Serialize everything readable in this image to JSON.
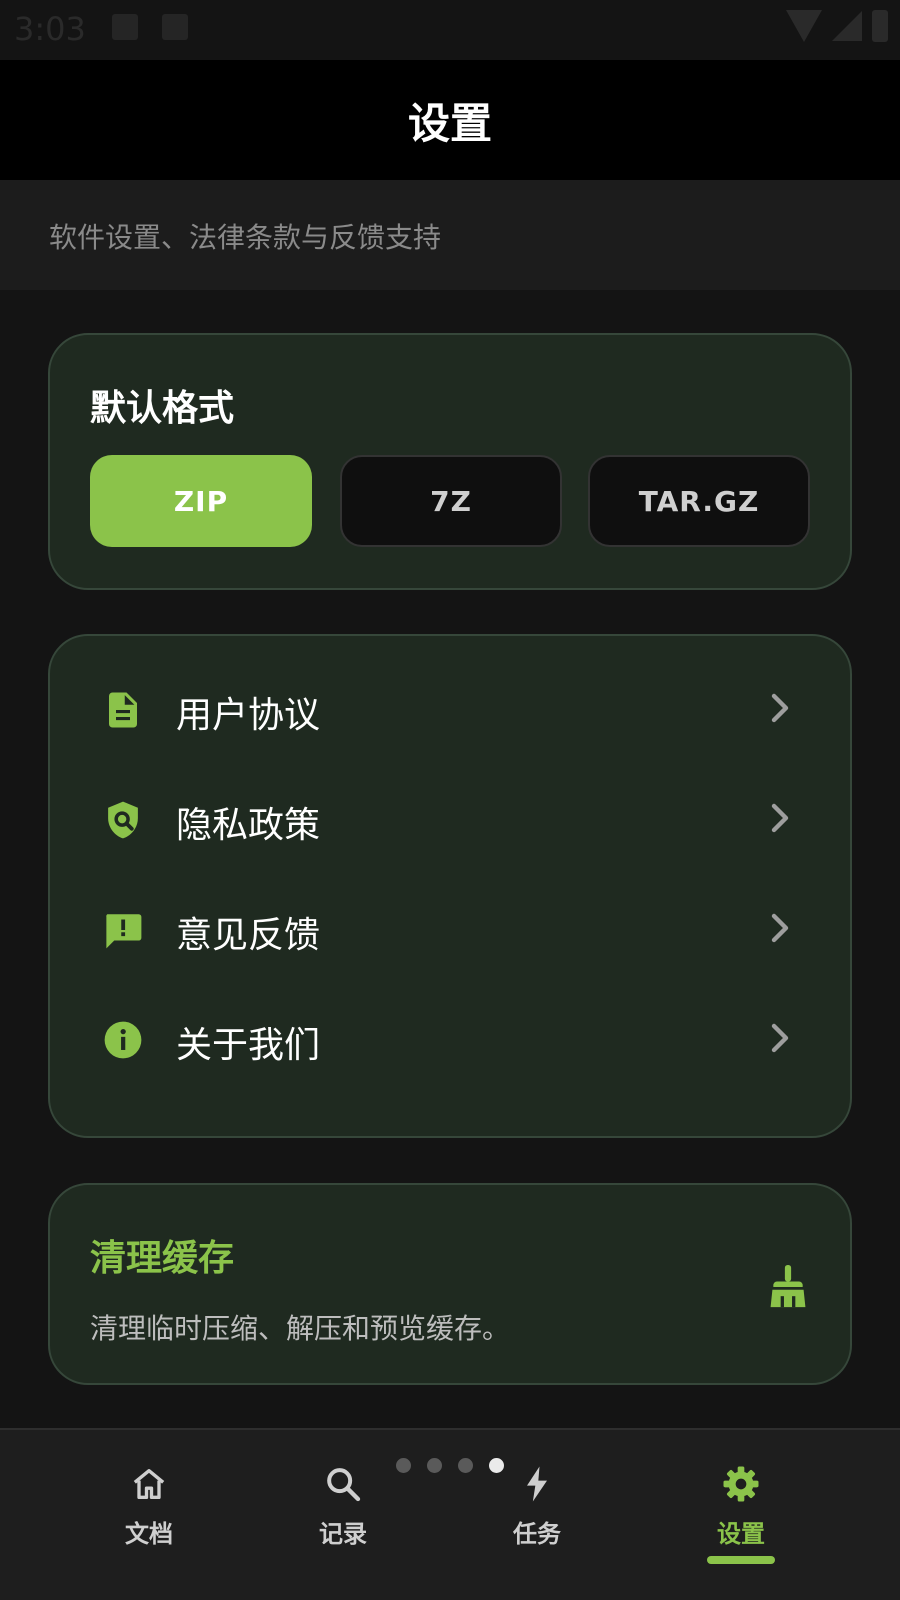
{
  "status_bar": {
    "time": "3:03"
  },
  "header": {
    "title": "设置",
    "subtitle": "软件设置、法律条款与反馈支持"
  },
  "default_format": {
    "label": "默认格式",
    "options": [
      "ZIP",
      "7Z",
      "TAR.GZ"
    ],
    "selected": "ZIP"
  },
  "menu": {
    "items": [
      {
        "label": "用户协议",
        "icon": "document-icon"
      },
      {
        "label": "隐私政策",
        "icon": "shield-search-icon"
      },
      {
        "label": "意见反馈",
        "icon": "feedback-icon"
      },
      {
        "label": "关于我们",
        "icon": "info-icon"
      }
    ]
  },
  "cache": {
    "title": "清理缓存",
    "description": "清理临时压缩、解压和预览缓存。",
    "icon": "broom-icon"
  },
  "bottom_nav": {
    "items": [
      {
        "label": "文档",
        "icon": "home-icon"
      },
      {
        "label": "记录",
        "icon": "search-icon"
      },
      {
        "label": "任务",
        "icon": "bolt-icon"
      },
      {
        "label": "设置",
        "icon": "gear-icon"
      }
    ],
    "active_index": 3,
    "page_indicator": {
      "count": 4,
      "active": 4
    }
  },
  "colors": {
    "accent": "#8bc34a",
    "background": "#141414",
    "card": "#1f2a20",
    "card_border": "#36473a"
  }
}
